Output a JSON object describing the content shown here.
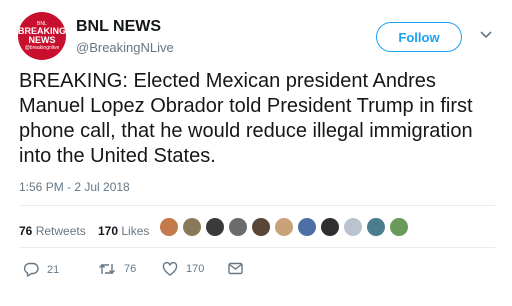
{
  "account": {
    "name": "BNL NEWS",
    "handle": "@BreakingNLive",
    "avatar_lines": [
      "BNL",
      "BREAKING",
      "NEWS",
      "@breakingnlive"
    ]
  },
  "follow_label": "Follow",
  "tweet": {
    "text": "BREAKING: Elected Mexican president Andres Manuel Lopez Obrador told President Trump in first phone call, that he would reduce illegal immigration into the United States.",
    "timestamp": "1:56 PM - 2 Jul 2018"
  },
  "stats": {
    "retweets_count": "76",
    "retweets_label": "Retweets",
    "likes_count": "170",
    "likes_label": "Likes"
  },
  "likers": [
    "#c47a4a",
    "#8a7a5c",
    "#3a3a3a",
    "#6b6b6b",
    "#5a4636",
    "#c9a27a",
    "#4d6fa3",
    "#2f2f2f",
    "#b9c4cf",
    "#4a7c8c",
    "#6a9a5a"
  ],
  "actions": {
    "reply_count": "21",
    "retweet_count": "76",
    "like_count": "170"
  },
  "colors": {
    "accent": "#1da1f2",
    "brand_red": "#c8102e",
    "muted": "#657786"
  },
  "icons": [
    "chevron-down-icon",
    "reply-icon",
    "retweet-icon",
    "heart-icon",
    "message-icon"
  ]
}
